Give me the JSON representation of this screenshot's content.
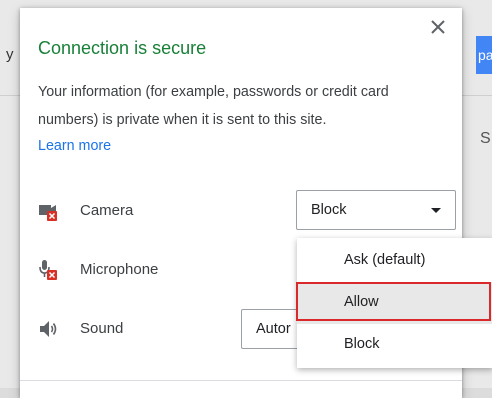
{
  "background": {
    "left_fragment": "y",
    "button_fragment": "pa",
    "right_fragment": "S"
  },
  "popup": {
    "title": "Connection is secure",
    "description": "Your information (for example, passwords or credit card numbers) is private when it is sent to this site.",
    "learn_more": "Learn more",
    "close_icon": "close-icon"
  },
  "permissions": [
    {
      "label": "Camera",
      "icon": "camera-blocked-icon",
      "value": "Block"
    },
    {
      "label": "Microphone",
      "icon": "microphone-blocked-icon",
      "value": ""
    },
    {
      "label": "Sound",
      "icon": "speaker-icon",
      "value": "Autor"
    }
  ],
  "dropdown": {
    "options": [
      "Ask (default)",
      "Allow",
      "Block"
    ],
    "highlighted": "Allow"
  },
  "colors": {
    "title": "#188038",
    "link": "#1a73e8",
    "highlight_border": "#d9292b",
    "blocked_badge": "#d93025"
  }
}
